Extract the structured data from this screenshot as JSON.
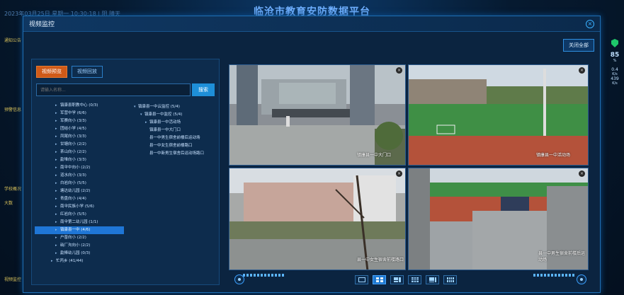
{
  "background": {
    "title": "临沧市教育安防数据平台",
    "date": "2023年03月25日 星期一 10:30:18 | 阴 晴天",
    "left_labels": [
      "通知公告",
      "预警信息",
      "学校概况",
      "大数",
      "视频监控"
    ],
    "right_values": [
      "85",
      "0.4",
      "439"
    ],
    "right_units": [
      "%",
      "K/s",
      "K/s"
    ]
  },
  "modal": {
    "title": "视频监控",
    "close_all_label": "关闭全部"
  },
  "left_panel": {
    "tabs": [
      {
        "label": "视频预览",
        "active": true
      },
      {
        "label": "视频回放",
        "active": false
      }
    ],
    "search_placeholder": "请输入名称...",
    "search_button": "搜索",
    "tree_left": [
      {
        "label": "镇康县职教中心 (0/3)",
        "selected": false
      },
      {
        "label": "军营中学 (6/6)",
        "selected": false
      },
      {
        "label": "军赛向小 (3/3)",
        "selected": false
      },
      {
        "label": "团结小学 (4/5)",
        "selected": false
      },
      {
        "label": "凤尾向小 (3/3)",
        "selected": false
      },
      {
        "label": "甘塘向小 (2/2)",
        "selected": false
      },
      {
        "label": "茶山向小 (2/2)",
        "selected": false
      },
      {
        "label": "勐堆向小 (3/3)",
        "selected": false
      },
      {
        "label": "南伞中向小 (2/2)",
        "selected": false
      },
      {
        "label": "道水向小 (3/3)",
        "selected": false
      },
      {
        "label": "白岩向小 (5/5)",
        "selected": false
      },
      {
        "label": "塘达幼儿园 (2/2)",
        "selected": false
      },
      {
        "label": "青盘向小 (4/4)",
        "selected": false
      },
      {
        "label": "南伞民族小学 (5/6)",
        "selected": false
      },
      {
        "label": "红岩向小 (5/5)",
        "selected": false
      },
      {
        "label": "南伞第二幼儿园 (1/1)",
        "selected": false
      },
      {
        "label": "镇康县一中 (4/6)",
        "selected": true
      },
      {
        "label": "户普向小 (2/2)",
        "selected": false
      },
      {
        "label": "硝厂沟向小 (2/2)",
        "selected": false
      },
      {
        "label": "勐捧幼儿园 (0/3)",
        "selected": false
      },
      {
        "label": "忙丙乡 (41/44)",
        "selected": false,
        "root": true
      }
    ],
    "tree_right": [
      {
        "label": "镇康县一中云监控 (5/4)",
        "level": 0
      },
      {
        "label": "镇康县一中监控 (5/4)",
        "level": 1
      },
      {
        "label": "镇康县一中活动场",
        "level": 2
      },
      {
        "label": "镇康县一中大门口",
        "level": 3
      },
      {
        "label": "县一中男生宿舍前楼后运动场",
        "level": 3
      },
      {
        "label": "县一中女生宿舍前楼路口",
        "level": 3
      },
      {
        "label": "县一中新男生宿舍后运动场路口",
        "level": 3
      }
    ]
  },
  "video_cells": [
    {
      "label": "镇康县一中大门口"
    },
    {
      "label": "镇康县一中活动场"
    },
    {
      "label": "县一中女生宿舍前楼路口"
    },
    {
      "label": "县一中男生宿舍前楼后运动场"
    }
  ],
  "layout_buttons": [
    "1x1",
    "2x2",
    "1+5",
    "3x3",
    "1+7",
    "4x4"
  ],
  "active_layout": "2x2",
  "colors": {
    "accent": "#1e8fd8",
    "active_tab": "#d05a18",
    "selected_row": "#1f76d6"
  }
}
